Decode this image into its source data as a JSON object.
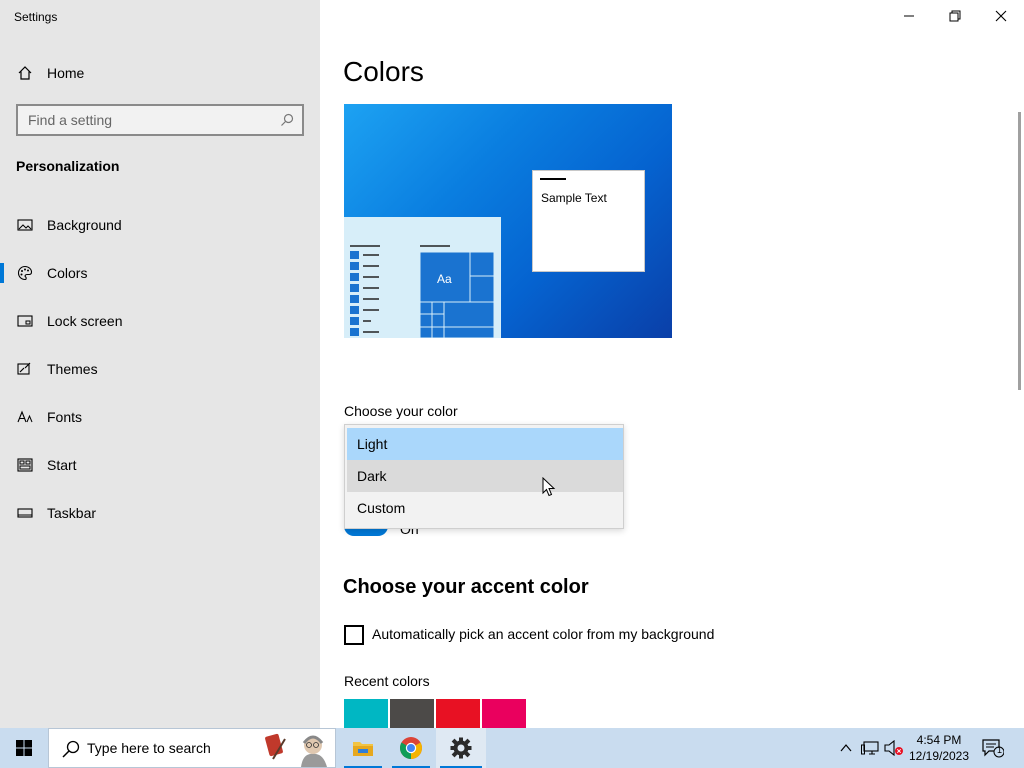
{
  "window": {
    "title": "Settings"
  },
  "sidebar": {
    "home_label": "Home",
    "search_placeholder": "Find a setting",
    "section_title": "Personalization",
    "items": [
      {
        "label": "Background",
        "icon": "picture-icon"
      },
      {
        "label": "Colors",
        "icon": "palette-icon",
        "active": true
      },
      {
        "label": "Lock screen",
        "icon": "lock-screen-icon"
      },
      {
        "label": "Themes",
        "icon": "brush-icon"
      },
      {
        "label": "Fonts",
        "icon": "font-icon"
      },
      {
        "label": "Start",
        "icon": "start-icon"
      },
      {
        "label": "Taskbar",
        "icon": "taskbar-icon"
      }
    ]
  },
  "main": {
    "title": "Colors",
    "preview": {
      "sample_text": "Sample Text",
      "tile_text": "Aa"
    },
    "choose_color_label": "Choose your color",
    "color_options": [
      {
        "label": "Light",
        "state": "selected"
      },
      {
        "label": "Dark",
        "state": "hover"
      },
      {
        "label": "Custom",
        "state": "normal"
      }
    ],
    "toggle_text": "On",
    "accent_heading": "Choose your accent color",
    "auto_accent_label": "Automatically pick an accent color from my background",
    "auto_accent_checked": false,
    "recent_colors_label": "Recent colors",
    "recent_colors": [
      "#00b7c3",
      "#4c4a48",
      "#e81123",
      "#ea005e"
    ]
  },
  "taskbar": {
    "search_placeholder": "Type here to search",
    "apps": [
      "file-explorer-icon",
      "chrome-icon",
      "settings-icon"
    ],
    "clock_time": "4:54 PM",
    "clock_date": "12/19/2023",
    "notification_count": "1"
  },
  "colors": {
    "accent": "#0078d7",
    "sidebar_bg": "#e6e6e6",
    "taskbar_bg": "#c9dcef"
  }
}
